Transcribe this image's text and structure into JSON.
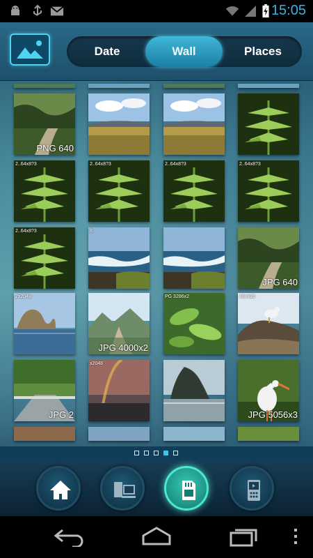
{
  "status_bar": {
    "time": "15:05",
    "left_icons": [
      "android-debug-icon",
      "usb-icon",
      "gmail-icon"
    ],
    "right_icons": [
      "wifi-icon",
      "signal-icon",
      "battery-charging-icon"
    ]
  },
  "header": {
    "logo_icon": "gallery-logo-icon",
    "tabs": [
      {
        "label": "Date"
      },
      {
        "label": "Wall"
      },
      {
        "label": "Places"
      }
    ],
    "active_tab": "Wall"
  },
  "wall": {
    "thumbnails": [
      {
        "subject": "forest path",
        "caption": "PNG 640"
      },
      {
        "subject": "meadow under sky",
        "caption": ""
      },
      {
        "subject": "meadow under sky",
        "caption": ""
      },
      {
        "subject": "fern leaves",
        "caption": ""
      },
      {
        "subject": "fern leaves",
        "caption": "2..64x8?3"
      },
      {
        "subject": "fern leaves",
        "caption": "2..64x8?3"
      },
      {
        "subject": "fern leaves",
        "caption": "2..64x8?3"
      },
      {
        "subject": "fern leaves",
        "caption": "2..64x8?3"
      },
      {
        "subject": "fern leaves",
        "caption": "2..64x8?3"
      },
      {
        "subject": "rocky shore waves",
        "caption": "8.."
      },
      {
        "subject": "rocky shore waves",
        "caption": ""
      },
      {
        "subject": "forest path",
        "caption": "JPG 640"
      },
      {
        "subject": "sea rocks",
        "caption": "2x2048"
      },
      {
        "subject": "mountain valley",
        "caption": "JPG 4000x2"
      },
      {
        "subject": "green leaves",
        "caption": "PG 3286x2"
      },
      {
        "subject": "seagull on rock",
        "caption": "40x426"
      },
      {
        "subject": "green road",
        "caption": "JPG 2"
      },
      {
        "subject": "rainbow sunset",
        "caption": "x2048"
      },
      {
        "subject": "haystack rock",
        "caption": ""
      },
      {
        "subject": "stork",
        "caption": "JPG 5056x3"
      }
    ]
  },
  "pager": {
    "pages": 5,
    "current_page": 4,
    "first_icon": "folder-icon"
  },
  "toolbar": {
    "buttons": [
      {
        "icon": "home-icon"
      },
      {
        "icon": "computer-icon"
      },
      {
        "icon": "sd-card-icon"
      },
      {
        "icon": "media-player-icon"
      }
    ],
    "active_button": "sd-card-icon"
  },
  "nav_bar": {
    "icons": [
      "back-icon",
      "home-nav-icon",
      "recent-apps-icon",
      "overflow-menu-icon"
    ]
  },
  "colors": {
    "accent": "#33b5e5",
    "active_tab": "#2a9fc6",
    "active_toolbar": "#2bb8a4",
    "header_bg": "#1d4f6b",
    "toolbar_bg": "#0b2232"
  }
}
